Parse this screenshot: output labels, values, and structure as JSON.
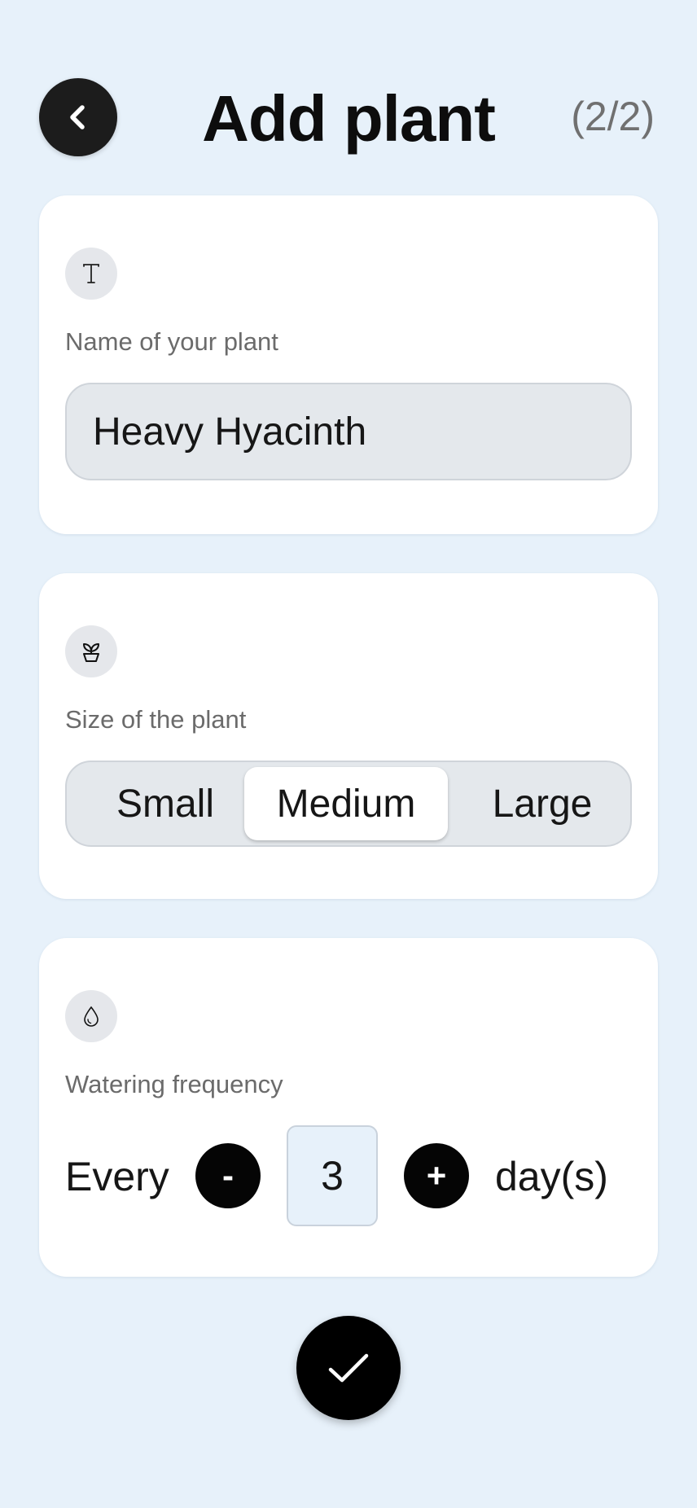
{
  "header": {
    "back_icon": "chevron-left-icon",
    "title": "Add plant",
    "step": "(2/2)"
  },
  "name_card": {
    "icon": "text-icon",
    "label": "Name of your plant",
    "value": "Heavy Hyacinth"
  },
  "size_card": {
    "icon": "plant-pot-icon",
    "label": "Size of the plant",
    "options": [
      "Small",
      "Medium",
      "Large"
    ],
    "selected": "Medium"
  },
  "watering_card": {
    "icon": "water-drop-icon",
    "label": "Watering frequency",
    "prefix": "Every",
    "decrement_label": "-",
    "value": "3",
    "increment_label": "+",
    "unit": "day(s)"
  },
  "confirm": {
    "icon": "checkmark-icon"
  },
  "colors": {
    "background": "#e7f1fa",
    "card": "#ffffff",
    "dark": "#000000"
  }
}
